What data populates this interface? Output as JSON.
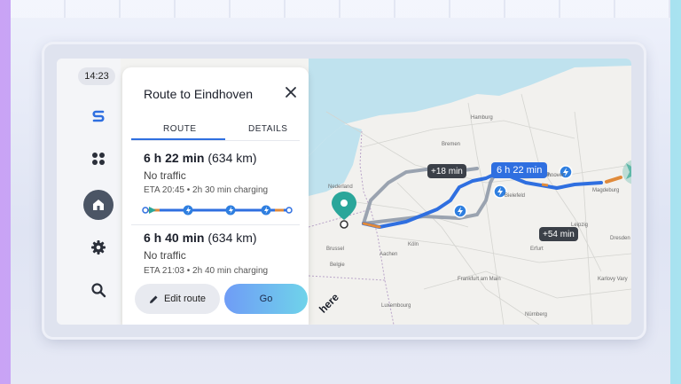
{
  "status": {
    "time": "14:23"
  },
  "rail": {
    "items": [
      {
        "icon": "route-s-icon"
      },
      {
        "icon": "apps-grid-icon"
      },
      {
        "icon": "home-icon"
      },
      {
        "icon": "gear-icon"
      },
      {
        "icon": "search-icon"
      }
    ]
  },
  "panel": {
    "title": "Route to Eindhoven",
    "tabs": [
      {
        "label": "ROUTE"
      },
      {
        "label": "DETAILS"
      }
    ],
    "routes": [
      {
        "duration": "6 h 22 min",
        "distance": "(634 km)",
        "traffic": "No traffic",
        "eta": "ETA 20:45",
        "charging": "2h 30 min charging"
      },
      {
        "duration": "6 h 40 min",
        "distance": "(634 km)",
        "traffic": "No traffic",
        "eta": "ETA 21:03",
        "charging": "2h 40 min charging"
      }
    ],
    "separator": "•"
  },
  "actions": {
    "edit_label": "Edit route",
    "go_label": "Go"
  },
  "map": {
    "route_labels": {
      "main": "6 h 22 min",
      "alt1": "+18 min",
      "alt2": "+54 min"
    },
    "cities": [
      "Hamburg",
      "Bremen",
      "Hannover",
      "Magdeburg",
      "Bielefeld",
      "Leipzig",
      "Köln",
      "Erfurt",
      "Dresden",
      "Frankfurt am Main",
      "Nürnberg",
      "Nederland",
      "Belgie",
      "Luxembourg",
      "Brussel",
      "Aachen",
      "Karlovy Vary"
    ],
    "brand": "here"
  },
  "colors": {
    "route": "#2f6fe0",
    "alt_route": "#9aa3b0",
    "charging": "#2f7fe0",
    "destination": "#2aa69a",
    "accent": "#6f9cf6"
  }
}
